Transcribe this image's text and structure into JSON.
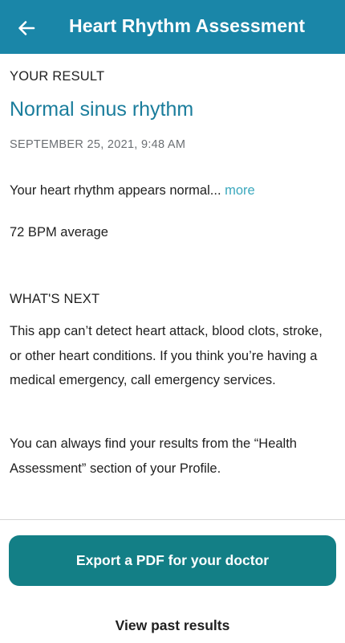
{
  "header": {
    "title": "Heart Rhythm Assessment",
    "back_icon": "arrow-left-icon",
    "background_color": "#1a86a8"
  },
  "result": {
    "section_label": "YOUR RESULT",
    "title": "Normal sinus rhythm",
    "date": "SEPTEMBER 25, 2021, 9:48 AM",
    "summary_text": "Your heart rhythm appears normal...",
    "more_label": "more",
    "bpm_text": "72 BPM average"
  },
  "next": {
    "section_label": "WHAT'S NEXT",
    "paragraph_1": "This app can’t detect heart attack, blood clots, stroke, or other heart conditions. If you think you’re having a medical emergency, call emergency services.",
    "paragraph_2": "You can always find your results from the “Health Assessment” section of your Profile."
  },
  "actions": {
    "export_label": "Export a PDF for your doctor",
    "export_color": "#137f86",
    "past_results_label": "View past results"
  }
}
